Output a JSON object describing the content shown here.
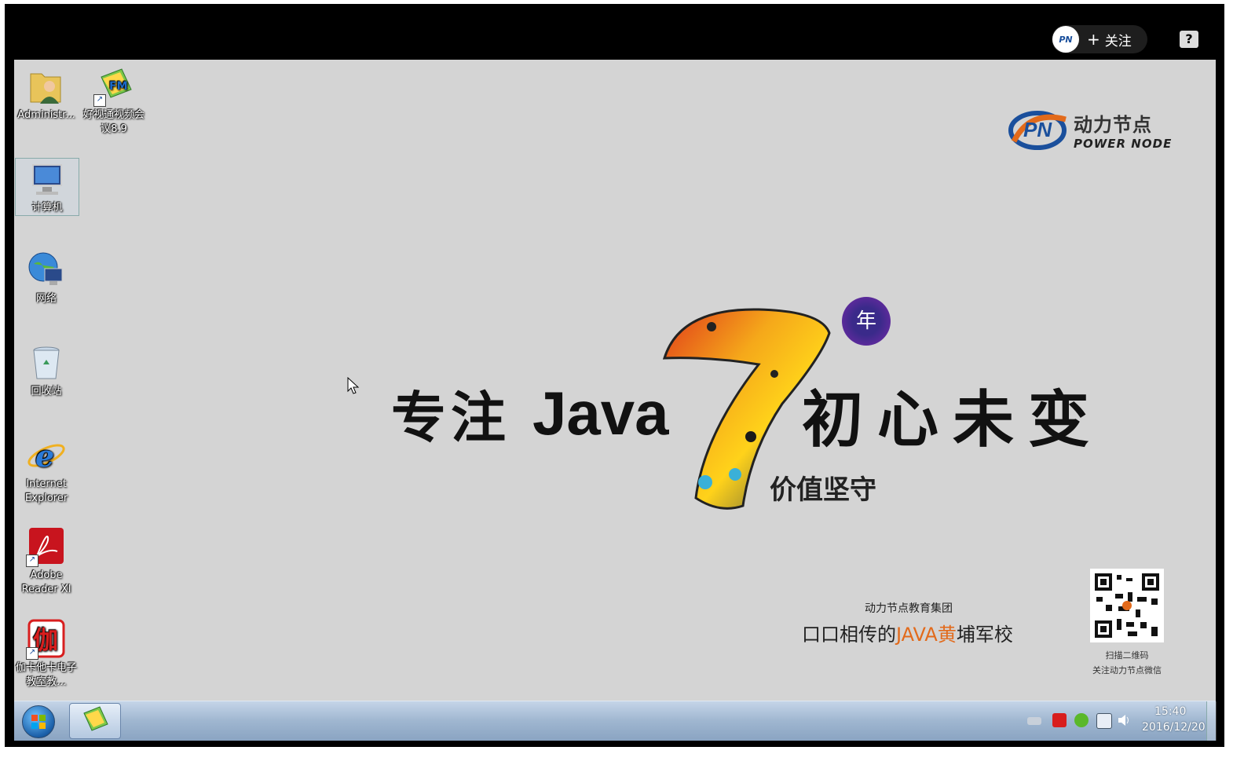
{
  "header": {
    "follow_label": "关注",
    "follow_plus": "+",
    "help_label": "?"
  },
  "desktop_icons": [
    {
      "label": "Administr..."
    },
    {
      "label": "好视通视频会议8.9"
    },
    {
      "label": "计算机"
    },
    {
      "label": "网络"
    },
    {
      "label": "回收站"
    },
    {
      "label": "Internet Explorer"
    },
    {
      "label": "Adobe Reader XI"
    },
    {
      "label": "伽卡他卡电子教室教..."
    }
  ],
  "wallpaper": {
    "brand_cn": "动力节点",
    "brand_en": "POWER NODE",
    "slogan_left": "专注",
    "slogan_java": "Java",
    "slogan_right": "初心未变",
    "year_badge": "年",
    "value_text": "价值坚守",
    "group_name": "动力节点教育集团",
    "motto_pre": "口口相传的",
    "motto_hl": "JAVA黄",
    "motto_post": "埔军校",
    "qr_caption_1": "扫描二维码",
    "qr_caption_2": "关注动力节点微信"
  },
  "taskbar": {
    "time": "15:40",
    "date": "2016/12/20"
  },
  "colors": {
    "accent_orange": "#e26a1b",
    "brand_blue": "#1a4f9c"
  }
}
